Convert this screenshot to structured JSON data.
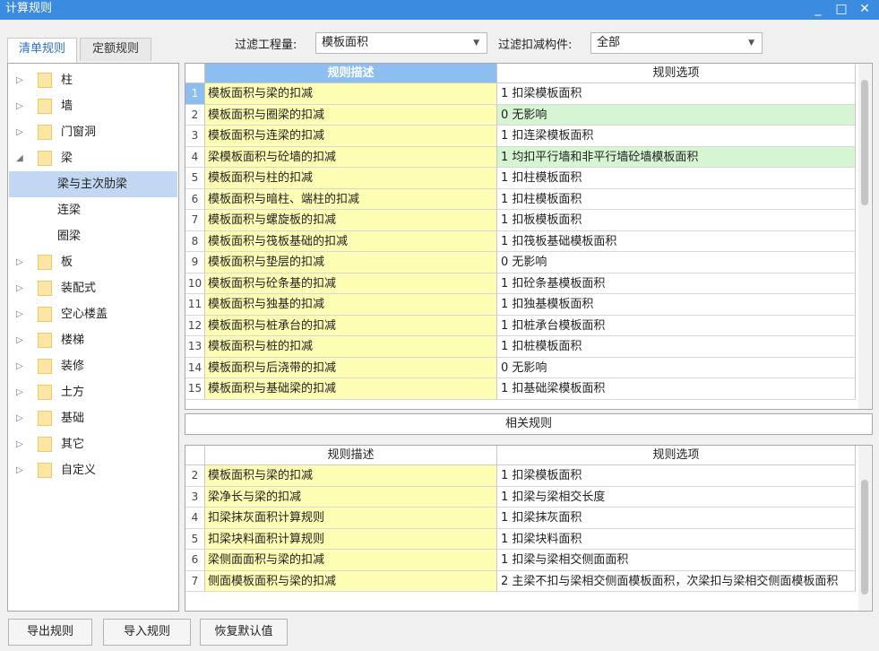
{
  "window": {
    "title": "计算规则"
  },
  "tabs": [
    {
      "label": "清单规则"
    },
    {
      "label": "定额规则"
    }
  ],
  "filters": {
    "project_label": "过滤工程量:",
    "project_value": "模板面积",
    "component_label": "过滤扣减构件:",
    "component_value": "全部"
  },
  "tree": [
    {
      "label": "柱",
      "folder": true,
      "expand": "▷"
    },
    {
      "label": "墙",
      "folder": true,
      "expand": "▷"
    },
    {
      "label": "门窗洞",
      "folder": true,
      "expand": "▷"
    },
    {
      "label": "梁",
      "folder": true,
      "expand": "◢"
    },
    {
      "label": "梁与主次肋梁",
      "folder": false,
      "selected": true
    },
    {
      "label": "连梁",
      "folder": false
    },
    {
      "label": "圈梁",
      "folder": false
    },
    {
      "label": "板",
      "folder": true,
      "expand": "▷"
    },
    {
      "label": "装配式",
      "folder": true,
      "expand": "▷"
    },
    {
      "label": "空心楼盖",
      "folder": true,
      "expand": "▷"
    },
    {
      "label": "楼梯",
      "folder": true,
      "expand": "▷"
    },
    {
      "label": "装修",
      "folder": true,
      "expand": "▷"
    },
    {
      "label": "土方",
      "folder": true,
      "expand": "▷"
    },
    {
      "label": "基础",
      "folder": true,
      "expand": "▷"
    },
    {
      "label": "其它",
      "folder": true,
      "expand": "▷"
    },
    {
      "label": "自定义",
      "folder": true,
      "expand": "▷"
    }
  ],
  "main_table": {
    "headers": {
      "desc": "规则描述",
      "option": "规则选项"
    },
    "rows": [
      {
        "n": "1",
        "desc": "模板面积与梁的扣减",
        "option": "1 扣梁模板面积",
        "green": false
      },
      {
        "n": "2",
        "desc": "模板面积与圈梁的扣减",
        "option": "0  无影响",
        "green": true
      },
      {
        "n": "3",
        "desc": "模板面积与连梁的扣减",
        "option": "1 扣连梁模板面积",
        "green": false
      },
      {
        "n": "4",
        "desc": "梁模板面积与砼墙的扣减",
        "option": "1 均扣平行墙和非平行墙砼墙模板面积",
        "green": true
      },
      {
        "n": "5",
        "desc": "模板面积与柱的扣减",
        "option": "1 扣柱模板面积",
        "green": false
      },
      {
        "n": "6",
        "desc": "模板面积与暗柱、端柱的扣减",
        "option": "1 扣柱模板面积",
        "green": false
      },
      {
        "n": "7",
        "desc": "模板面积与螺旋板的扣减",
        "option": "1 扣板模板面积",
        "green": false
      },
      {
        "n": "8",
        "desc": "模板面积与筏板基础的扣减",
        "option": "1 扣筏板基础模板面积",
        "green": false
      },
      {
        "n": "9",
        "desc": "模板面积与垫层的扣减",
        "option": "0  无影响",
        "green": false
      },
      {
        "n": "10",
        "desc": "模板面积与砼条基的扣减",
        "option": "1 扣砼条基模板面积",
        "green": false
      },
      {
        "n": "11",
        "desc": "模板面积与独基的扣减",
        "option": "1 扣独基模板面积",
        "green": false
      },
      {
        "n": "12",
        "desc": "模板面积与桩承台的扣减",
        "option": "1 扣桩承台模板面积",
        "green": false
      },
      {
        "n": "13",
        "desc": "模板面积与桩的扣减",
        "option": "1 扣桩模板面积",
        "green": false
      },
      {
        "n": "14",
        "desc": "模板面积与后浇带的扣减",
        "option": "0  无影响",
        "green": false
      },
      {
        "n": "15",
        "desc": "模板面积与基础梁的扣减",
        "option": "1 扣基础梁模板面积",
        "green": false
      }
    ]
  },
  "related": {
    "title": "相关规则",
    "headers": {
      "desc": "规则描述",
      "option": "规则选项"
    },
    "rows": [
      {
        "n": "2",
        "desc": "模板面积与梁的扣减",
        "option": "1 扣梁模板面积"
      },
      {
        "n": "3",
        "desc": "梁净长与梁的扣减",
        "option": "1 扣梁与梁相交长度"
      },
      {
        "n": "4",
        "desc": "扣梁抹灰面积计算规则",
        "option": "1 扣梁抹灰面积"
      },
      {
        "n": "5",
        "desc": "扣梁块料面积计算规则",
        "option": "1 扣梁块料面积"
      },
      {
        "n": "6",
        "desc": "梁侧面面积与梁的扣减",
        "option": "1 扣梁与梁相交侧面面积"
      },
      {
        "n": "7",
        "desc": "侧面模板面积与梁的扣减",
        "option": "2 主梁不扣与梁相交侧面模板面积，次梁扣与梁相交侧面模板面积"
      }
    ]
  },
  "buttons": {
    "export": "导出规则",
    "import": "导入规则",
    "restore": "恢复默认值"
  },
  "icons": {
    "minimize": "minimize-icon",
    "maximize": "maximize-icon",
    "close": "close-icon"
  }
}
